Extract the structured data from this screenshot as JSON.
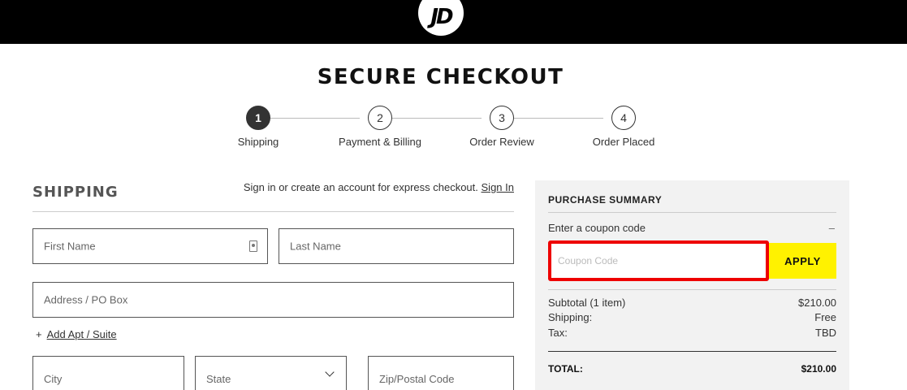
{
  "brand": {
    "logo_text": "JD"
  },
  "page": {
    "title": "SECURE CHECKOUT"
  },
  "steps": [
    {
      "number": "1",
      "label": "Shipping"
    },
    {
      "number": "2",
      "label": "Payment & Billing"
    },
    {
      "number": "3",
      "label": "Order Review"
    },
    {
      "number": "4",
      "label": "Order Placed"
    }
  ],
  "shipping": {
    "title": "SHIPPING",
    "signin_prompt": "Sign in or create an account for express checkout.",
    "signin_link": "Sign In",
    "first_name_placeholder": "First Name",
    "last_name_placeholder": "Last Name",
    "address_placeholder": "Address / PO Box",
    "add_apt_icon": "+",
    "add_apt_label": "Add Apt / Suite",
    "city_placeholder": "City",
    "state_placeholder": "State",
    "zip_placeholder": "Zip/Postal Code"
  },
  "summary": {
    "title": "PURCHASE SUMMARY",
    "coupon_label": "Enter a coupon code",
    "coupon_toggle": "–",
    "coupon_placeholder": "Coupon Code",
    "apply_label": "APPLY",
    "subtotal_label": "Subtotal (1 item)",
    "subtotal_value": "$210.00",
    "shipping_label": "Shipping:",
    "shipping_value": "Free",
    "tax_label": "Tax:",
    "tax_value": "TBD",
    "total_label": "TOTAL:",
    "total_value": "$210.00"
  },
  "colors": {
    "accent_apply": "#fff200",
    "highlight": "#ee0000",
    "header": "#000000"
  }
}
